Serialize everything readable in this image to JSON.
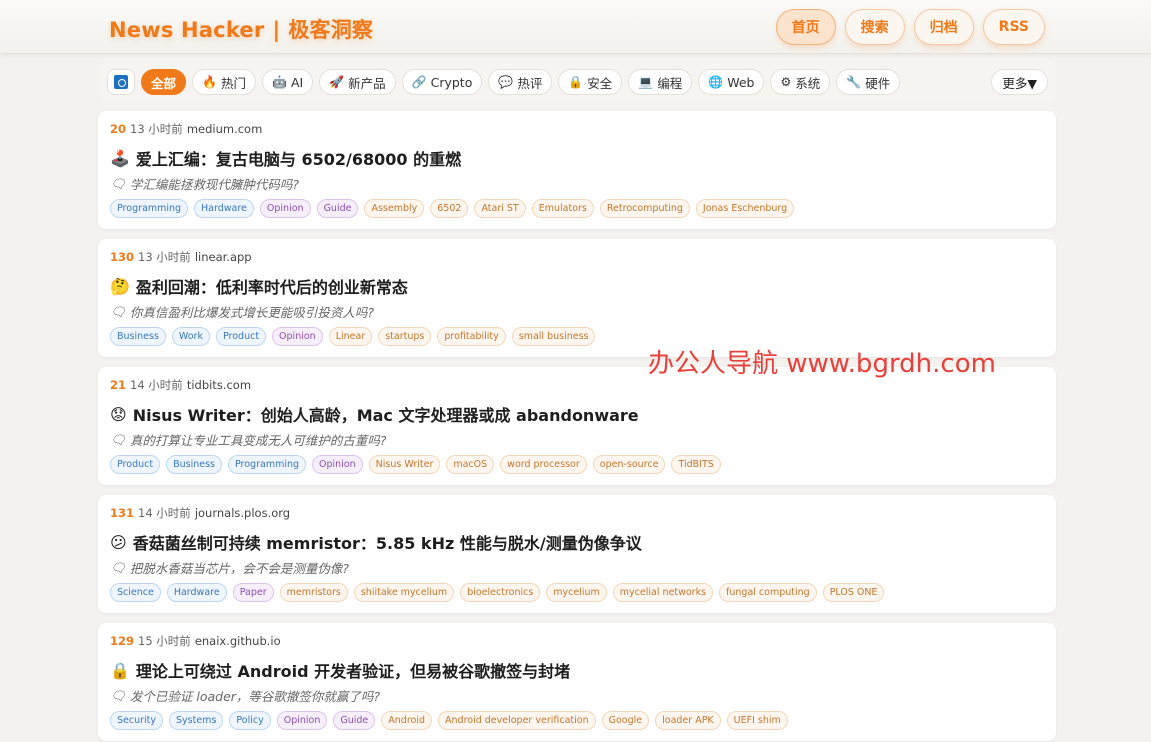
{
  "header": {
    "brand_en": "News Hacker",
    "brand_sep": "|",
    "brand_cn": "极客洞察",
    "nav": [
      {
        "label": "首页",
        "active": true
      },
      {
        "label": "搜索",
        "active": false
      },
      {
        "label": "归档",
        "active": false
      },
      {
        "label": "RSS",
        "active": false
      }
    ]
  },
  "categories": [
    {
      "label": "全部",
      "icon": "",
      "active": true
    },
    {
      "label": "热门",
      "icon": "🔥"
    },
    {
      "label": "AI",
      "icon": "🤖"
    },
    {
      "label": "新产品",
      "icon": "🚀"
    },
    {
      "label": "Crypto",
      "icon": "🔗"
    },
    {
      "label": "热评",
      "icon": "💬"
    },
    {
      "label": "安全",
      "icon": "🔒"
    },
    {
      "label": "编程",
      "icon": "💻"
    },
    {
      "label": "Web",
      "icon": "🌐"
    },
    {
      "label": "系统",
      "icon": "⚙"
    },
    {
      "label": "硬件",
      "icon": "🔧"
    }
  ],
  "more_label": "更多▼",
  "stories": [
    {
      "score": "20",
      "time": "13 小时前",
      "domain": "medium.com",
      "emoji": "🕹️",
      "title": "爱上汇编：复古电脑与 6502/68000 的重燃",
      "subtitle": "学汇编能拯救现代臃肿代码吗?",
      "tags": [
        {
          "label": "Programming",
          "color": "blue"
        },
        {
          "label": "Hardware",
          "color": "blue"
        },
        {
          "label": "Opinion",
          "color": "purple"
        },
        {
          "label": "Guide",
          "color": "purple"
        },
        {
          "label": "Assembly",
          "color": "orange"
        },
        {
          "label": "6502",
          "color": "orange"
        },
        {
          "label": "Atari ST",
          "color": "orange"
        },
        {
          "label": "Emulators",
          "color": "orange"
        },
        {
          "label": "Retrocomputing",
          "color": "orange"
        },
        {
          "label": "Jonas Eschenburg",
          "color": "orange"
        }
      ]
    },
    {
      "score": "130",
      "time": "13 小时前",
      "domain": "linear.app",
      "emoji": "🤔",
      "title": "盈利回潮：低利率时代后的创业新常态",
      "subtitle": "你真信盈利比爆发式增长更能吸引投资人吗?",
      "tags": [
        {
          "label": "Business",
          "color": "blue"
        },
        {
          "label": "Work",
          "color": "blue"
        },
        {
          "label": "Product",
          "color": "blue"
        },
        {
          "label": "Opinion",
          "color": "purple"
        },
        {
          "label": "Linear",
          "color": "orange"
        },
        {
          "label": "startups",
          "color": "orange"
        },
        {
          "label": "profitability",
          "color": "orange"
        },
        {
          "label": "small business",
          "color": "orange"
        }
      ]
    },
    {
      "score": "21",
      "time": "14 小时前",
      "domain": "tidbits.com",
      "emoji": "😟",
      "title": "Nisus Writer：创始人高龄，Mac 文字处理器或成 abandonware",
      "subtitle": "真的打算让专业工具变成无人可维护的古董吗?",
      "tags": [
        {
          "label": "Product",
          "color": "blue"
        },
        {
          "label": "Business",
          "color": "blue"
        },
        {
          "label": "Programming",
          "color": "blue"
        },
        {
          "label": "Opinion",
          "color": "purple"
        },
        {
          "label": "Nisus Writer",
          "color": "orange"
        },
        {
          "label": "macOS",
          "color": "orange"
        },
        {
          "label": "word processor",
          "color": "orange"
        },
        {
          "label": "open-source",
          "color": "orange"
        },
        {
          "label": "TidBITS",
          "color": "orange"
        }
      ]
    },
    {
      "score": "131",
      "time": "14 小时前",
      "domain": "journals.plos.org",
      "emoji": "😕",
      "title": "香菇菌丝制可持续 memristor：5.85 kHz 性能与脱水/测量伪像争议",
      "subtitle": "把脱水香菇当芯片，会不会是测量伪像?",
      "tags": [
        {
          "label": "Science",
          "color": "blue"
        },
        {
          "label": "Hardware",
          "color": "blue"
        },
        {
          "label": "Paper",
          "color": "purple"
        },
        {
          "label": "memristors",
          "color": "orange"
        },
        {
          "label": "shiitake mycelium",
          "color": "orange"
        },
        {
          "label": "bioelectronics",
          "color": "orange"
        },
        {
          "label": "mycelium",
          "color": "orange"
        },
        {
          "label": "mycelial networks",
          "color": "orange"
        },
        {
          "label": "fungal computing",
          "color": "orange"
        },
        {
          "label": "PLOS ONE",
          "color": "orange"
        }
      ]
    },
    {
      "score": "129",
      "time": "15 小时前",
      "domain": "enaix.github.io",
      "emoji": "🔒",
      "title": "理论上可绕过 Android 开发者验证，但易被谷歌撤签与封堵",
      "subtitle": "发个已验证 loader，等谷歌撤签你就赢了吗?",
      "tags": [
        {
          "label": "Security",
          "color": "blue"
        },
        {
          "label": "Systems",
          "color": "blue"
        },
        {
          "label": "Policy",
          "color": "blue"
        },
        {
          "label": "Opinion",
          "color": "purple"
        },
        {
          "label": "Guide",
          "color": "purple"
        },
        {
          "label": "Android",
          "color": "orange"
        },
        {
          "label": "Android developer verification",
          "color": "orange"
        },
        {
          "label": "Google",
          "color": "orange"
        },
        {
          "label": "loader APK",
          "color": "orange"
        },
        {
          "label": "UEFI shim",
          "color": "orange"
        }
      ]
    }
  ],
  "watermark": "办公人导航  www.bgrdh.com"
}
